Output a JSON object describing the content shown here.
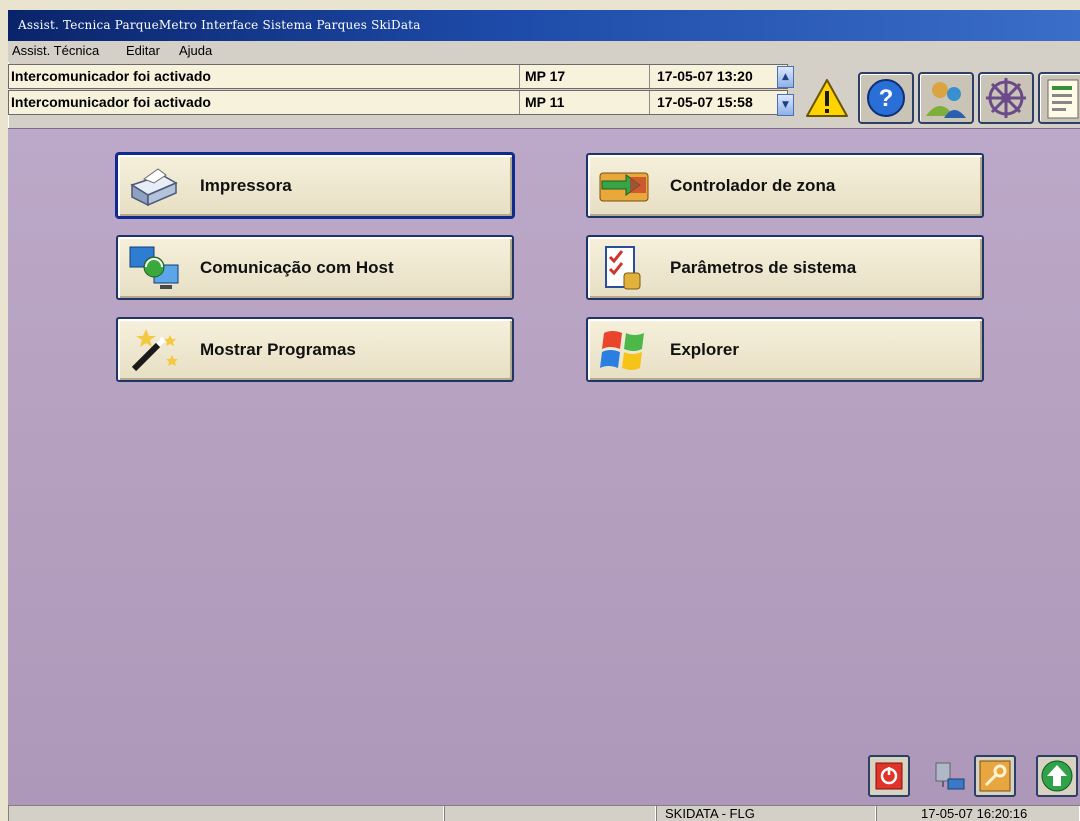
{
  "window": {
    "title": "Assist. Tecnica  ParqueMetro Interface  Sistema Parques SkiData"
  },
  "menu": {
    "items": [
      "Assist. Técnica",
      "Editar",
      "Ajuda"
    ]
  },
  "alarms": [
    {
      "message": "Intercomunicador foi activado",
      "source": "MP 17",
      "time": "17-05-07 13:20"
    },
    {
      "message": "Intercomunicador foi activado",
      "source": "MP 11",
      "time": "17-05-07 15:58"
    }
  ],
  "toolbar": {
    "icons": [
      "warning-icon",
      "help-icon",
      "user-group-icon",
      "wheel-icon",
      "report-icon"
    ]
  },
  "functions": [
    {
      "label": "Impressora",
      "icon": "printer-icon"
    },
    {
      "label": "Controlador de zona",
      "icon": "zone-controller-icon"
    },
    {
      "label": "Comunicação com Host",
      "icon": "host-communication-icon"
    },
    {
      "label": "Parâmetros de sistema",
      "icon": "system-parameters-icon"
    },
    {
      "label": "Mostrar Programas",
      "icon": "magic-wand-icon"
    },
    {
      "label": "Explorer",
      "icon": "windows-logo-icon"
    }
  ],
  "status": {
    "host": "SKIDATA - FLG",
    "datetime": "17-05-07 16:20:16"
  },
  "colors": {
    "title_bar": "#0a246a",
    "panel": "#b7a2c2",
    "button_face": "#f2ebd4",
    "button_border": "#1f3566"
  }
}
